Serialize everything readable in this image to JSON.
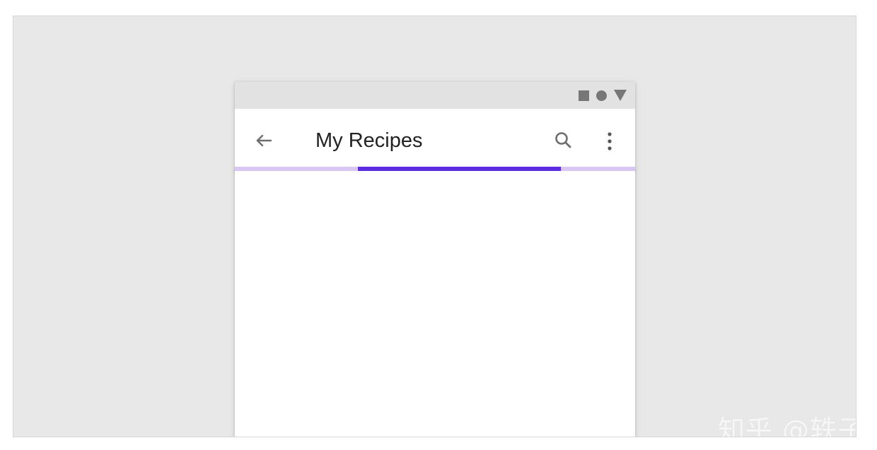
{
  "screen": {
    "status_bar": {
      "icons": [
        "square-icon",
        "circle-icon",
        "triangle-icon"
      ],
      "color": "#777777",
      "background": "#e2e2e2"
    },
    "app_bar": {
      "title": "My Recipes",
      "back_icon": "arrow-left-icon",
      "search_icon": "search-icon",
      "more_icon": "more-vert-icon"
    },
    "progress": {
      "start": 0.308,
      "end": 0.814,
      "track_color": "#d7c7f2",
      "indicator_color": "#5b2ce0"
    }
  },
  "watermark": {
    "text": "知乎 @轶子"
  },
  "colors": {
    "frame_background": "#e8e8e8",
    "phone_background": "#ffffff",
    "title_color": "#222222",
    "icon_color": "#6d6d6d"
  }
}
